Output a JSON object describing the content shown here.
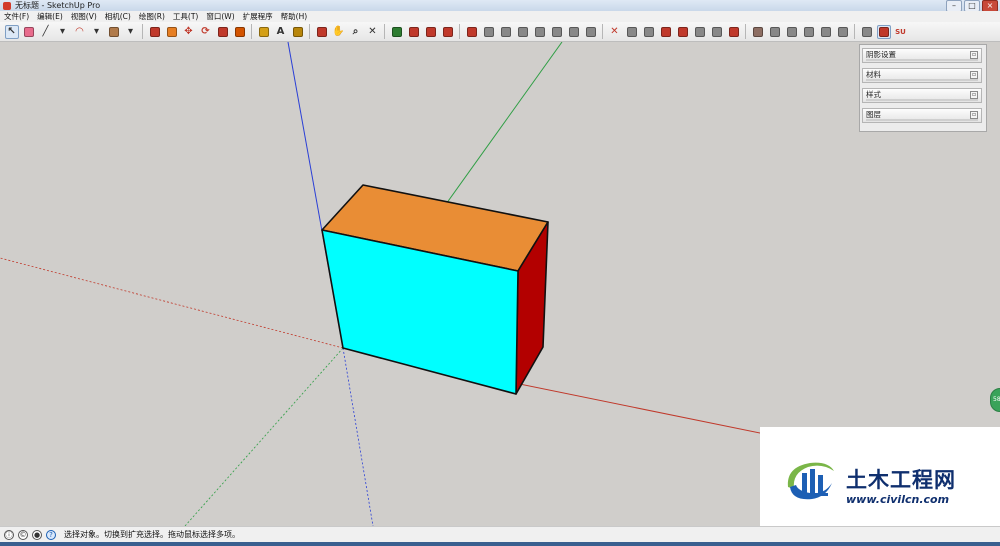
{
  "window": {
    "title": "无标题 - SketchUp Pro",
    "controls": [
      "–",
      "□",
      "×"
    ]
  },
  "menu": [
    {
      "label": "文件(F)"
    },
    {
      "label": "编辑(E)"
    },
    {
      "label": "视图(V)"
    },
    {
      "label": "相机(C)"
    },
    {
      "label": "绘图(R)"
    },
    {
      "label": "工具(T)"
    },
    {
      "label": "窗口(W)"
    },
    {
      "label": "扩展程序"
    },
    {
      "label": "帮助(H)"
    }
  ],
  "toolbar": {
    "groups": [
      [
        {
          "name": "select-tool-icon",
          "glyph": "↖",
          "active": true
        },
        {
          "name": "eraser-tool-icon",
          "glyph": "",
          "color": "#e86b8c"
        },
        {
          "name": "line-tool-icon",
          "glyph": "╱"
        },
        {
          "name": "line-dropdown-icon",
          "glyph": "▾"
        },
        {
          "name": "arc-tool-icon",
          "glyph": "◠",
          "color": "#c0392b"
        },
        {
          "name": "arc-dropdown-icon",
          "glyph": "▾"
        },
        {
          "name": "shape-tool-icon",
          "glyph": "",
          "color": "#b07a4a"
        },
        {
          "name": "shape-dropdown-icon",
          "glyph": "▾"
        }
      ],
      [
        {
          "name": "push-pull-tool-icon",
          "glyph": "",
          "color": "#c0392b"
        },
        {
          "name": "follow-me-tool-icon",
          "glyph": "",
          "color": "#e67e22"
        },
        {
          "name": "move-tool-icon",
          "glyph": "✥",
          "color": "#c0392b"
        },
        {
          "name": "rotate-tool-icon",
          "glyph": "⟳",
          "color": "#c0392b"
        },
        {
          "name": "scale-tool-icon",
          "glyph": "",
          "color": "#c0392b"
        },
        {
          "name": "offset-tool-icon",
          "glyph": "",
          "color": "#d35400"
        }
      ],
      [
        {
          "name": "tape-measure-tool-icon",
          "glyph": "",
          "color": "#d4a017"
        },
        {
          "name": "text-tool-icon",
          "glyph": "A"
        },
        {
          "name": "paint-bucket-tool-icon",
          "glyph": "",
          "color": "#b8860b"
        }
      ],
      [
        {
          "name": "orbit-tool-icon",
          "glyph": "",
          "color": "#c0392b"
        },
        {
          "name": "pan-tool-icon",
          "glyph": "✋"
        },
        {
          "name": "zoom-tool-icon",
          "glyph": "⌕"
        },
        {
          "name": "zoom-extents-tool-icon",
          "glyph": "✕"
        }
      ],
      [
        {
          "name": "3d-warehouse-icon",
          "glyph": "",
          "color": "#2e7d32"
        },
        {
          "name": "extension-warehouse-icon",
          "glyph": "",
          "color": "#c0392b"
        },
        {
          "name": "share-model-icon",
          "glyph": "",
          "color": "#c0392b"
        },
        {
          "name": "layout-send-icon",
          "glyph": "",
          "color": "#c0392b"
        }
      ],
      [
        {
          "name": "iso-view-icon",
          "glyph": "",
          "color": "#c0392b"
        },
        {
          "name": "top-view-icon",
          "glyph": "",
          "color": "#888888"
        },
        {
          "name": "front-view-icon",
          "glyph": "",
          "color": "#888888"
        },
        {
          "name": "right-view-icon",
          "glyph": "",
          "color": "#888888"
        },
        {
          "name": "back-view-icon",
          "glyph": "",
          "color": "#888888"
        },
        {
          "name": "left-view-icon",
          "glyph": "",
          "color": "#888888"
        },
        {
          "name": "xray-style-icon",
          "glyph": "",
          "color": "#888888"
        },
        {
          "name": "wireframe-style-icon",
          "glyph": "",
          "color": "#888888"
        }
      ],
      [
        {
          "name": "sandbox-from-contours-icon",
          "glyph": "✕",
          "color": "#c0392b"
        },
        {
          "name": "sandbox-from-scratch-icon",
          "glyph": "",
          "color": "#888888"
        },
        {
          "name": "smoove-tool-icon",
          "glyph": "",
          "color": "#888888"
        },
        {
          "name": "stamp-tool-icon",
          "glyph": "",
          "color": "#c0392b"
        },
        {
          "name": "drape-tool-icon",
          "glyph": "",
          "color": "#c0392b"
        },
        {
          "name": "add-detail-tool-icon",
          "glyph": "",
          "color": "#888888"
        },
        {
          "name": "flip-edge-tool-icon",
          "glyph": "",
          "color": "#888888"
        },
        {
          "name": "solid-tools-icon",
          "glyph": "",
          "color": "#c0392b"
        }
      ],
      [
        {
          "name": "outer-shell-icon",
          "glyph": "",
          "color": "#8d6e63"
        },
        {
          "name": "intersect-icon",
          "glyph": "",
          "color": "#888888"
        },
        {
          "name": "union-icon",
          "glyph": "",
          "color": "#888888"
        },
        {
          "name": "subtract-icon",
          "glyph": "",
          "color": "#888888"
        },
        {
          "name": "trim-icon",
          "glyph": "",
          "color": "#888888"
        },
        {
          "name": "split-icon",
          "glyph": "",
          "color": "#888888"
        }
      ],
      [
        {
          "name": "section-plane-icon",
          "glyph": "",
          "color": "#888888"
        },
        {
          "name": "display-section-icon",
          "glyph": "",
          "color": "#c0392b",
          "active": true
        },
        {
          "name": "su-logo-icon",
          "glyph": "SU",
          "color": "#c0392b"
        }
      ]
    ]
  },
  "tray": {
    "panels": [
      {
        "label": "阴影设置"
      },
      {
        "label": "材料"
      },
      {
        "label": "样式"
      },
      {
        "label": "图层"
      }
    ]
  },
  "model": {
    "top_face_color": "#e98d35",
    "front_face_color": "#00ffff",
    "side_face_color": "#b30000",
    "axis_red": "#c0392b",
    "axis_green": "#2e9e44",
    "axis_blue": "#2a3fd6"
  },
  "side_badge": {
    "label": "58"
  },
  "watermark": {
    "title": "土木工程网",
    "url": "www.civilcn.com"
  },
  "status": {
    "text": "选择对象。切换到扩充选择。拖动鼠标选择多项。"
  }
}
